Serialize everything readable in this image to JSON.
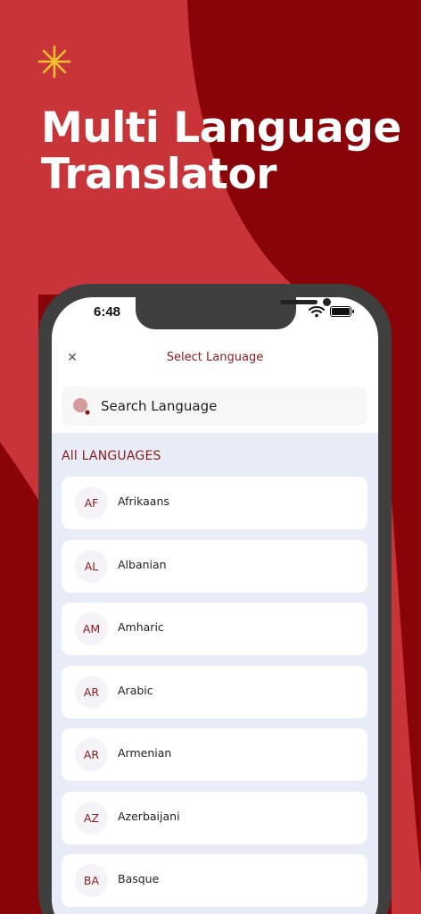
{
  "colors": {
    "dark_red": "#880409",
    "light_red": "#c93438",
    "accent_star": "#f2c230",
    "title_red": "#8b1a1e"
  },
  "headline": {
    "line1": "Multi Language",
    "line2": "Translator"
  },
  "status_bar": {
    "time": "6:48"
  },
  "header": {
    "title": "Select Language",
    "close_icon": "close-icon"
  },
  "search": {
    "placeholder": "Search Language",
    "icon": "search-icon"
  },
  "list": {
    "section_label": "All LANGUAGES",
    "items": [
      {
        "code": "AF",
        "name": "Afrikaans"
      },
      {
        "code": "AL",
        "name": "Albanian"
      },
      {
        "code": "AM",
        "name": "Amharic"
      },
      {
        "code": "AR",
        "name": "Arabic"
      },
      {
        "code": "AR",
        "name": "Armenian"
      },
      {
        "code": "AZ",
        "name": "Azerbaijani"
      },
      {
        "code": "BA",
        "name": "Basque"
      }
    ]
  }
}
